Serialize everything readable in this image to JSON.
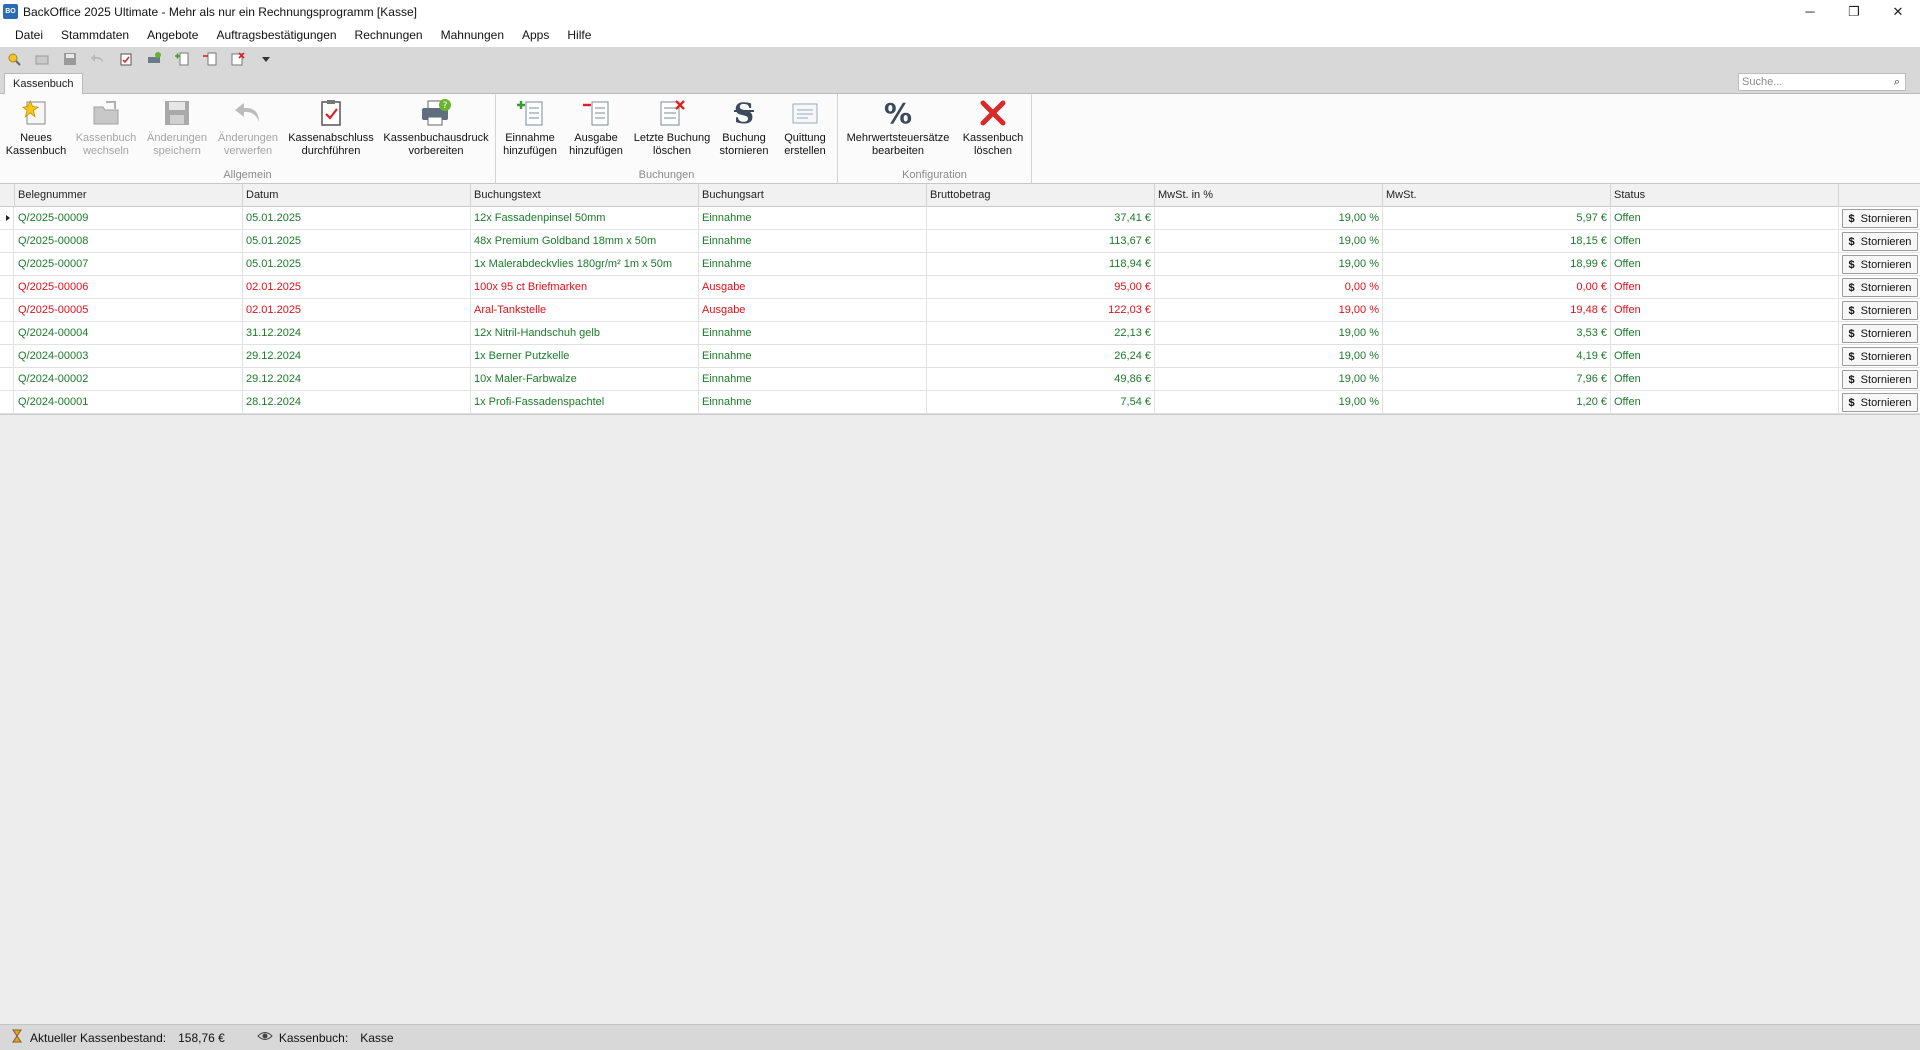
{
  "window": {
    "title": "BackOffice 2025 Ultimate - Mehr als nur ein Rechnungsprogramm [Kasse]",
    "app_icon_text": "BO",
    "minimize": "─",
    "restore": "❐",
    "close": "✕"
  },
  "menu": [
    "Datei",
    "Stammdaten",
    "Angebote",
    "Auftragsbestätigungen",
    "Rechnungen",
    "Mahnungen",
    "Apps",
    "Hilfe"
  ],
  "qat_icons": [
    "new-cashbook-icon",
    "open-icon",
    "save-icon",
    "undo-icon",
    "clipboard-icon",
    "printer-icon",
    "add-entry-icon",
    "remove-entry-icon",
    "delete-entry-icon",
    "dropdown-arrow-icon"
  ],
  "tabs": {
    "active": "Kassenbuch"
  },
  "search": {
    "placeholder": "Suche..."
  },
  "ribbon": {
    "groups": [
      {
        "caption": "Allgemein",
        "buttons": [
          {
            "label": "Neues\nKassenbuch",
            "icon": "new-cashbook-icon",
            "enabled": true
          },
          {
            "label": "Kassenbuch\nwechseln",
            "icon": "folder-open-icon",
            "enabled": false
          },
          {
            "label": "Änderungen\nspeichern",
            "icon": "save-icon",
            "enabled": false
          },
          {
            "label": "Änderungen\nverwerfen",
            "icon": "undo-icon",
            "enabled": false
          },
          {
            "label": "Kassenabschluss\ndurchführen",
            "icon": "clipboard-check-icon",
            "enabled": true
          },
          {
            "label": "Kassenbuchausdruck\nvorbereiten",
            "icon": "printer-icon",
            "enabled": true
          }
        ]
      },
      {
        "caption": "Buchungen",
        "buttons": [
          {
            "label": "Einnahme\nhinzufügen",
            "icon": "add-income-icon",
            "enabled": true
          },
          {
            "label": "Ausgabe\nhinzufügen",
            "icon": "add-expense-icon",
            "enabled": true
          },
          {
            "label": "Letzte Buchung\nlöschen",
            "icon": "delete-last-entry-icon",
            "enabled": true
          },
          {
            "label": "Buchung\nstornieren",
            "icon": "cancel-entry-icon",
            "enabled": true
          },
          {
            "label": "Quittung\nerstellen",
            "icon": "receipt-icon",
            "enabled": true
          }
        ]
      },
      {
        "caption": "Konfiguration",
        "buttons": [
          {
            "label": "Mehrwertsteuersätze\nbearbeiten",
            "icon": "percent-icon",
            "enabled": true
          },
          {
            "label": "Kassenbuch\nlöschen",
            "icon": "delete-cashbook-icon",
            "enabled": true
          }
        ]
      }
    ]
  },
  "grid": {
    "columns": [
      "Belegnummer",
      "Datum",
      "Buchungstext",
      "Buchungsart",
      "Bruttobetrag",
      "MwSt. in %",
      "MwSt.",
      "Status"
    ],
    "action_label": "Stornieren",
    "rows": [
      {
        "beleg": "Q/2025-00009",
        "datum": "05.01.2025",
        "text": "12x Fassadenpinsel 50mm",
        "art": "Einnahme",
        "brutto": "37,41 €",
        "mwst_pct": "19,00 %",
        "mwst": "5,97 €",
        "status": "Offen"
      },
      {
        "beleg": "Q/2025-00008",
        "datum": "05.01.2025",
        "text": "48x Premium Goldband 18mm x 50m",
        "art": "Einnahme",
        "brutto": "113,67 €",
        "mwst_pct": "19,00 %",
        "mwst": "18,15 €",
        "status": "Offen"
      },
      {
        "beleg": "Q/2025-00007",
        "datum": "05.01.2025",
        "text": "1x Malerabdeckvlies 180gr/m² 1m x 50m",
        "art": "Einnahme",
        "brutto": "118,94 €",
        "mwst_pct": "19,00 %",
        "mwst": "18,99 €",
        "status": "Offen"
      },
      {
        "beleg": "Q/2025-00006",
        "datum": "02.01.2025",
        "text": "100x 95 ct Briefmarken",
        "art": "Ausgabe",
        "brutto": "95,00 €",
        "mwst_pct": "0,00 %",
        "mwst": "0,00 €",
        "status": "Offen"
      },
      {
        "beleg": "Q/2025-00005",
        "datum": "02.01.2025",
        "text": "Aral-Tankstelle",
        "art": "Ausgabe",
        "brutto": "122,03 €",
        "mwst_pct": "19,00 %",
        "mwst": "19,48 €",
        "status": "Offen"
      },
      {
        "beleg": "Q/2024-00004",
        "datum": "31.12.2024",
        "text": "12x Nitril-Handschuh gelb",
        "art": "Einnahme",
        "brutto": "22,13 €",
        "mwst_pct": "19,00 %",
        "mwst": "3,53 €",
        "status": "Offen"
      },
      {
        "beleg": "Q/2024-00003",
        "datum": "29.12.2024",
        "text": "1x Berner Putzkelle",
        "art": "Einnahme",
        "brutto": "26,24 €",
        "mwst_pct": "19,00 %",
        "mwst": "4,19 €",
        "status": "Offen"
      },
      {
        "beleg": "Q/2024-00002",
        "datum": "29.12.2024",
        "text": "10x Maler-Farbwalze",
        "art": "Einnahme",
        "brutto": "49,86 €",
        "mwst_pct": "19,00 %",
        "mwst": "7,96 €",
        "status": "Offen"
      },
      {
        "beleg": "Q/2024-00001",
        "datum": "28.12.2024",
        "text": "1x Profi-Fassadenspachtel",
        "art": "Einnahme",
        "brutto": "7,54 €",
        "mwst_pct": "19,00 %",
        "mwst": "1,20 €",
        "status": "Offen"
      }
    ]
  },
  "colors": {
    "income": "#1c7a2a",
    "expense": "#e0101b"
  },
  "statusbar": {
    "balance_label": "Aktueller Kassenbestand:",
    "balance_value": "158,76 €",
    "cashbook_label": "Kassenbuch:",
    "cashbook_value": "Kasse"
  }
}
